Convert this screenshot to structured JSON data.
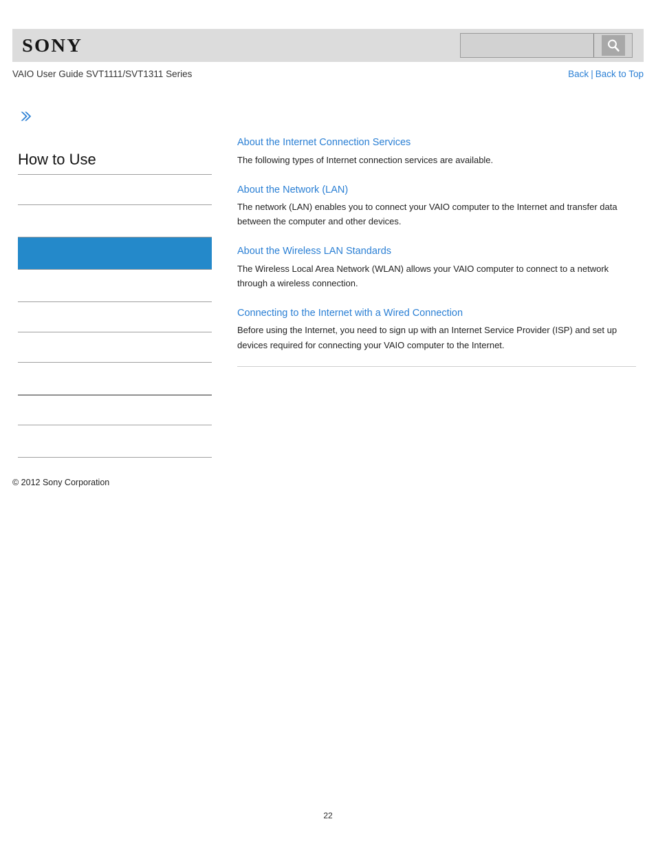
{
  "header": {
    "logo_text": "SONY",
    "logo_name": "sony-logo"
  },
  "search": {
    "value": "",
    "placeholder": "",
    "icon": "search-icon",
    "button_label": ""
  },
  "subheader": {
    "guide_title": "VAIO User Guide SVT1111/SVT1311 Series",
    "back_label": "Back",
    "separator": "|",
    "back_to_top_label": "Back to Top"
  },
  "sidebar": {
    "expand_icon": "double-chevron-right-icon",
    "heading": "How to Use",
    "selected_index": 2,
    "items": [
      {
        "label": "",
        "selected": false
      },
      {
        "label": "",
        "selected": false
      },
      {
        "label": "",
        "selected": true
      },
      {
        "label": "",
        "selected": false
      },
      {
        "label": "",
        "selected": false
      },
      {
        "label": "",
        "selected": false
      },
      {
        "label": "",
        "selected": false
      },
      {
        "label": "",
        "selected": false
      },
      {
        "label": "",
        "selected": false
      }
    ]
  },
  "copyright": "© 2012 Sony Corporation",
  "main": {
    "topics": [
      {
        "title": "About the Internet Connection Services",
        "description": "The following types of Internet connection services are available."
      },
      {
        "title": "About the Network (LAN)",
        "description": "The network (LAN) enables you to connect your VAIO computer to the Internet and transfer data between the computer and other devices."
      },
      {
        "title": "About the Wireless LAN Standards",
        "description": "The Wireless Local Area Network (WLAN) allows your VAIO computer to connect to a network through a wireless connection."
      },
      {
        "title": "Connecting to the Internet with a Wired Connection",
        "description": "Before using the Internet, you need to sign up with an Internet Service Provider (ISP) and set up devices required for connecting your VAIO computer to the Internet."
      }
    ]
  },
  "footer": {
    "page_number": "22"
  },
  "colors": {
    "link": "#2a7fd4",
    "selected_nav": "#2489ca",
    "masthead_bg": "#dcdcdc",
    "rule": "#9f9f9f"
  }
}
